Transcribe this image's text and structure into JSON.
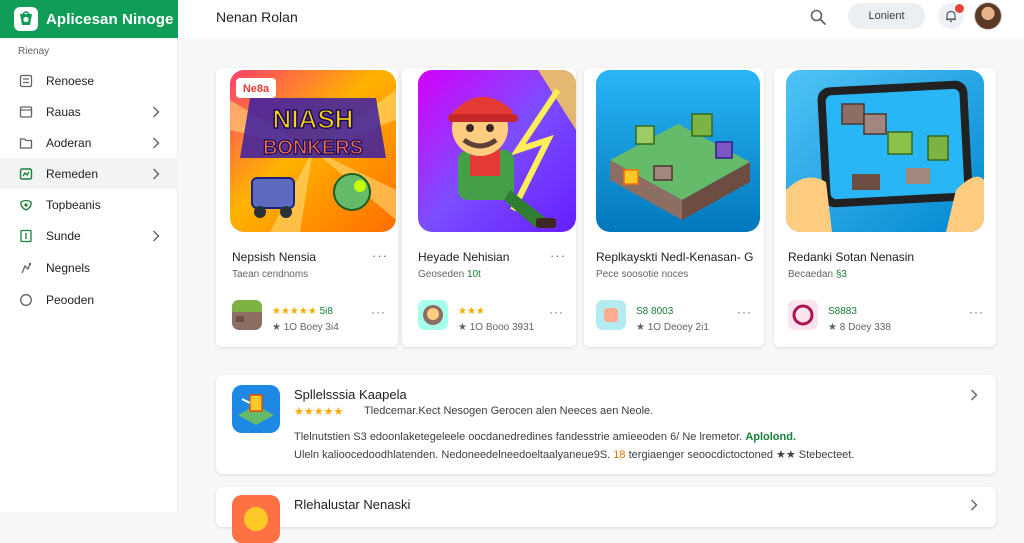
{
  "app": {
    "title": "Aplicesan Ninoge",
    "page_title": "Nenan Rolan",
    "accent": "#0f9d58"
  },
  "header": {
    "search_icon": "search-icon",
    "pill_label": "Lonient",
    "notification_icon": "bell-icon",
    "notification_badge_color": "#ea4335"
  },
  "sidebar": {
    "heading": "Rienay",
    "items": [
      {
        "label": "Renoese",
        "icon": "apps-icon",
        "chevron": false,
        "active": false
      },
      {
        "label": "Rauas",
        "icon": "window-icon",
        "chevron": true,
        "active": false
      },
      {
        "label": "Aoderan",
        "icon": "folder-icon",
        "chevron": true,
        "active": false
      },
      {
        "label": "Remeden",
        "icon": "gamepad-icon",
        "chevron": true,
        "active": true
      },
      {
        "label": "Topbeanis",
        "icon": "spark-icon",
        "chevron": false,
        "active": false
      },
      {
        "label": "Sunde",
        "icon": "bookmark-icon",
        "chevron": true,
        "active": false
      },
      {
        "label": "Negnels",
        "icon": "person-icon",
        "chevron": false,
        "active": false
      },
      {
        "label": "Peooden",
        "icon": "circle-icon",
        "chevron": false,
        "active": false
      }
    ]
  },
  "cards": [
    {
      "art_text": [
        "NIASH",
        "BONKERS"
      ],
      "art_badge": "Ne8a",
      "title": "Nepsish Nensia",
      "subtitle": "Taean cendnoms",
      "subtitle_accent": "",
      "more": "···",
      "rating_stars": "★★★★★",
      "rating_text": "5i8",
      "meta": "★ 1O Boey 3i4",
      "more2": "···"
    },
    {
      "art_text": [],
      "art_badge": "",
      "title": "Heyade Nehisian",
      "subtitle": "Geoseden",
      "subtitle_accent": "10t",
      "more": "···",
      "rating_stars": "★★★",
      "rating_text": "",
      "meta": "★ 1O Booo 3931",
      "more2": "···"
    },
    {
      "art_text": [],
      "art_badge": "",
      "title": "Replkayskti Nedl-Kenasan- G",
      "subtitle": "Pece soosotie noces",
      "subtitle_accent": "",
      "more": "···",
      "rating_stars": "",
      "rating_text": "S8 8003",
      "meta": "★ 1O Deoey 2i1",
      "more2": "···"
    },
    {
      "art_text": [],
      "art_badge": "",
      "title": "Redanki Sotan Nenasin",
      "subtitle": "Becaedan",
      "subtitle_accent": "§3",
      "more": "···",
      "rating_stars": "",
      "rating_text": "S8883",
      "meta": "★ 8 Doey 338",
      "more2": "···"
    }
  ],
  "rows": [
    {
      "title": "Spllelsssia Kaapela",
      "stars": "★★★★★",
      "desc": "Tledcemar.Kect Nesogen Gerocen alen Neeces aen Neole.",
      "body_line1": "Tlelnutstien S3 edoonlaketegeleele oocdanedredines fandesstrie amieeoden 6/ Ne lremetor.",
      "body_line1_accent": "Aplolond.",
      "body_line2_prefix": "Uleln kalioocedoodhlatenden.",
      "body_line2_mid": "Nedoneedelneedoeltaalyaneue9S.",
      "body_line2_num": "18",
      "body_line2_suffix": "tergiaenger seoocdictoctoned ★★ Stebecteet."
    },
    {
      "title": "Rlehalustar Nenaski"
    }
  ],
  "icons": {
    "chevron": "chevron-right-icon",
    "more": "more-dots-icon"
  }
}
